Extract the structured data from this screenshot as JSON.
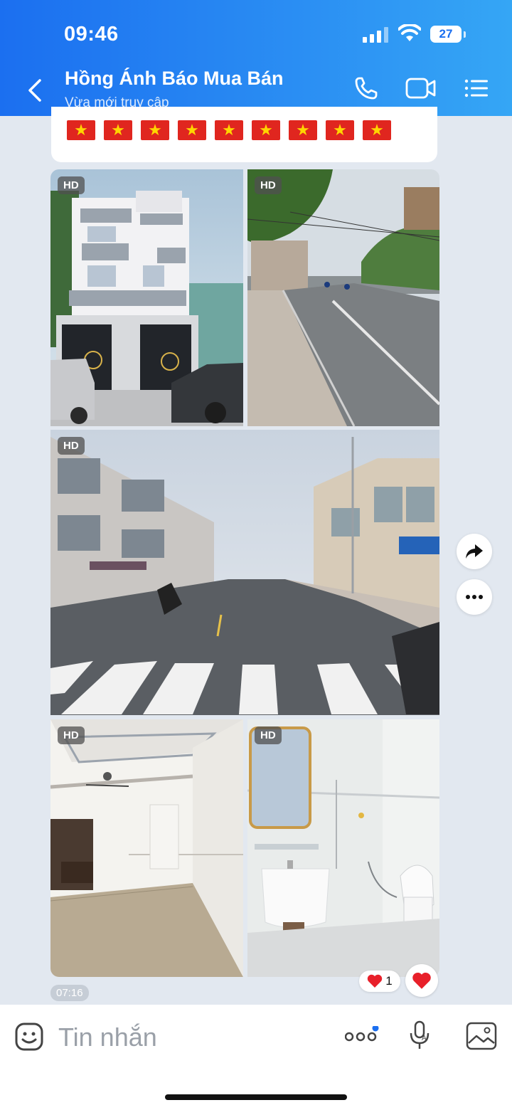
{
  "status_bar": {
    "time": "09:46",
    "battery": "27"
  },
  "header": {
    "contact_name": "Hồng Ánh Báo Mua Bán",
    "status": "Vừa mới truy cập"
  },
  "message": {
    "flag_count": 9,
    "photos": [
      {
        "badge": "HD",
        "subject": "townhouse-facade"
      },
      {
        "badge": "HD",
        "subject": "street-view"
      },
      {
        "badge": "HD",
        "subject": "wide-street-crosswalk"
      },
      {
        "badge": "HD",
        "subject": "interior-room"
      },
      {
        "badge": "HD",
        "subject": "bathroom"
      }
    ],
    "timestamp": "07:16",
    "reaction_count": "1"
  },
  "input": {
    "placeholder": "Tin nhắn"
  },
  "colors": {
    "accent": "#1b6ff0",
    "flag_red": "#e0261f",
    "flag_star": "#ffd600",
    "heart": "#e8202a"
  }
}
